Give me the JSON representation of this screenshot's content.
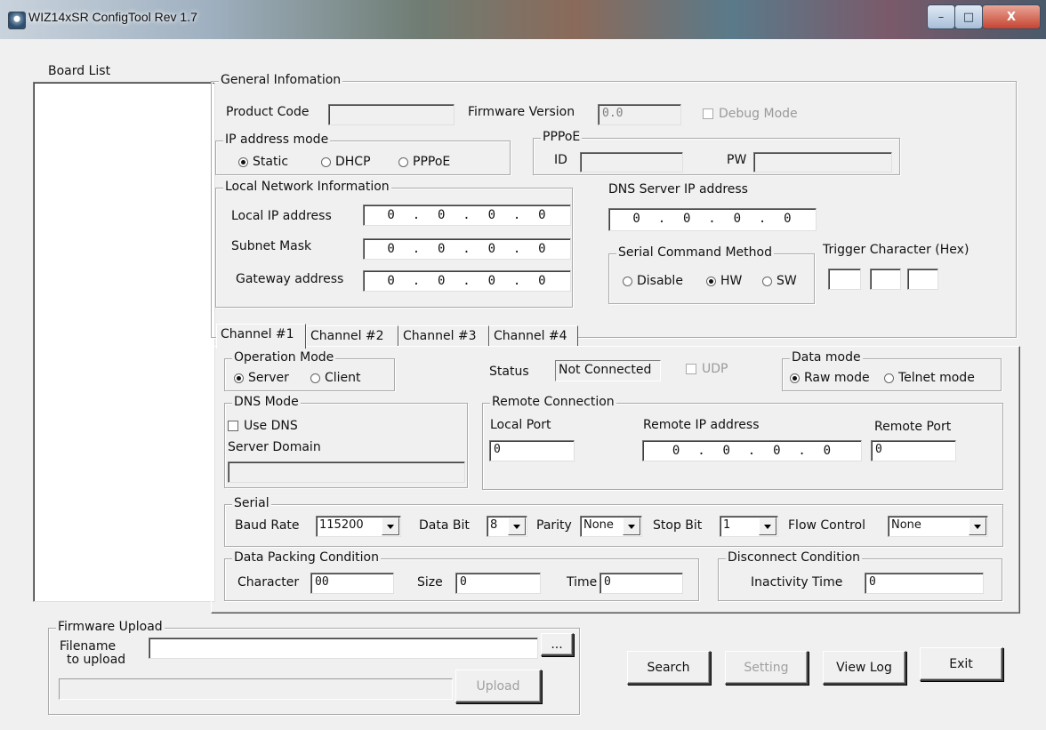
{
  "window": {
    "title": "WIZ14xSR ConfigTool Rev 1.7",
    "min": "–",
    "max": "□",
    "close": "X"
  },
  "board_list": {
    "label": "Board List"
  },
  "general": {
    "title": "General Infomation",
    "product_code_label": "Product Code",
    "product_code_value": "",
    "firmware_version_label": "Firmware Version",
    "firmware_version_value": "0.0",
    "debug_mode_label": "Debug Mode",
    "ip_mode": {
      "title": "IP address mode",
      "options": [
        "Static",
        "DHCP",
        "PPPoE"
      ],
      "selected": "Static"
    },
    "pppoe": {
      "title": "PPPoE",
      "id_label": "ID",
      "id_value": "",
      "pw_label": "PW",
      "pw_value": ""
    },
    "local_net": {
      "title": "Local Network Information",
      "local_ip_label": "Local IP address",
      "local_ip": "0  .  0  .  0  .  0",
      "subnet_label": "Subnet Mask",
      "subnet": "0  .  0  .  0  .  0",
      "gateway_label": "Gateway address",
      "gateway": "0  .  0  .  0  .  0"
    },
    "dns_label": "DNS Server IP address",
    "dns_ip": "0  .  0  .  0  .  0",
    "serial_cmd": {
      "title": "Serial Command Method",
      "options": [
        "Disable",
        "HW",
        "SW"
      ],
      "selected": "HW"
    },
    "trigger_label": "Trigger Character (Hex)"
  },
  "tabs": [
    "Channel #1",
    "Channel #2",
    "Channel #3",
    "Channel #4"
  ],
  "channel": {
    "operation_mode": {
      "title": "Operation Mode",
      "options": [
        "Server",
        "Client"
      ],
      "selected": "Server"
    },
    "status_label": "Status",
    "status_value": "Not Connected",
    "udp_label": "UDP",
    "data_mode": {
      "title": "Data mode",
      "options": [
        "Raw mode",
        "Telnet mode"
      ],
      "selected": "Raw mode"
    },
    "dns_mode": {
      "title": "DNS Mode",
      "use_dns_label": "Use DNS",
      "server_domain_label": "Server Domain",
      "server_domain_value": ""
    },
    "remote": {
      "title": "Remote Connection",
      "local_port_label": "Local Port",
      "local_port_value": "0",
      "remote_ip_label": "Remote IP address",
      "remote_ip": "0  .  0  .  0  .  0",
      "remote_port_label": "Remote Port",
      "remote_port_value": "0"
    },
    "serial": {
      "title": "Serial",
      "baud_label": "Baud Rate",
      "baud_value": "115200",
      "databit_label": "Data Bit",
      "databit_value": "8",
      "parity_label": "Parity",
      "parity_value": "None",
      "stopbit_label": "Stop Bit",
      "stopbit_value": "1",
      "flow_label": "Flow Control",
      "flow_value": "None"
    },
    "packing": {
      "title": "Data Packing Condition",
      "char_label": "Character",
      "char_value": "00",
      "size_label": "Size",
      "size_value": "0",
      "time_label": "Time",
      "time_value": "0"
    },
    "disconnect": {
      "title": "Disconnect Condition",
      "inactivity_label": "Inactivity Time",
      "inactivity_value": "0"
    }
  },
  "firmware": {
    "title": "Firmware Upload",
    "filename_label_1": "Filename",
    "filename_label_2": "to upload",
    "filename_value": "",
    "browse_label": "...",
    "upload_label": "Upload"
  },
  "buttons": {
    "search": "Search",
    "setting": "Setting",
    "view_log": "View Log",
    "exit": "Exit"
  }
}
